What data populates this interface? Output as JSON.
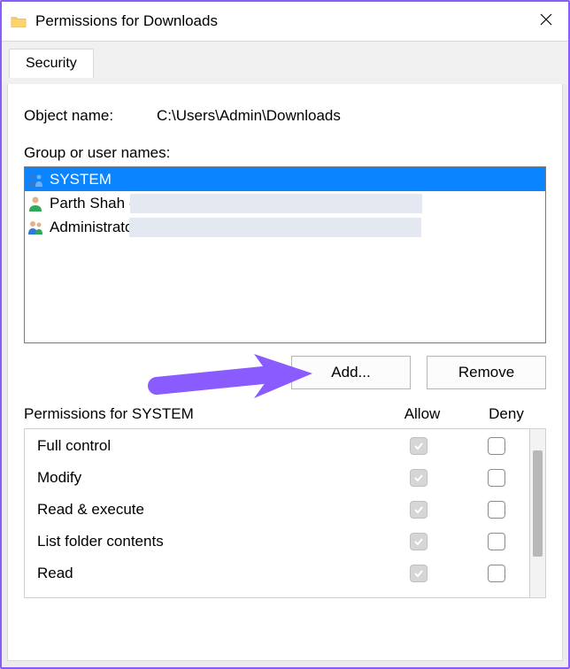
{
  "window": {
    "title": "Permissions for Downloads"
  },
  "tabs": {
    "security": "Security"
  },
  "object": {
    "label": "Object name:",
    "value": "C:\\Users\\Admin\\Downloads"
  },
  "group_label": "Group or user names:",
  "users": {
    "system": "SYSTEM",
    "parth": "Parth Shah (",
    "admins": "Administrato"
  },
  "buttons": {
    "add": "Add...",
    "remove": "Remove"
  },
  "perm_header": {
    "title": "Permissions for SYSTEM",
    "allow": "Allow",
    "deny": "Deny"
  },
  "perms": {
    "full": "Full control",
    "modify": "Modify",
    "readex": "Read & execute",
    "list": "List folder contents",
    "read": "Read"
  }
}
